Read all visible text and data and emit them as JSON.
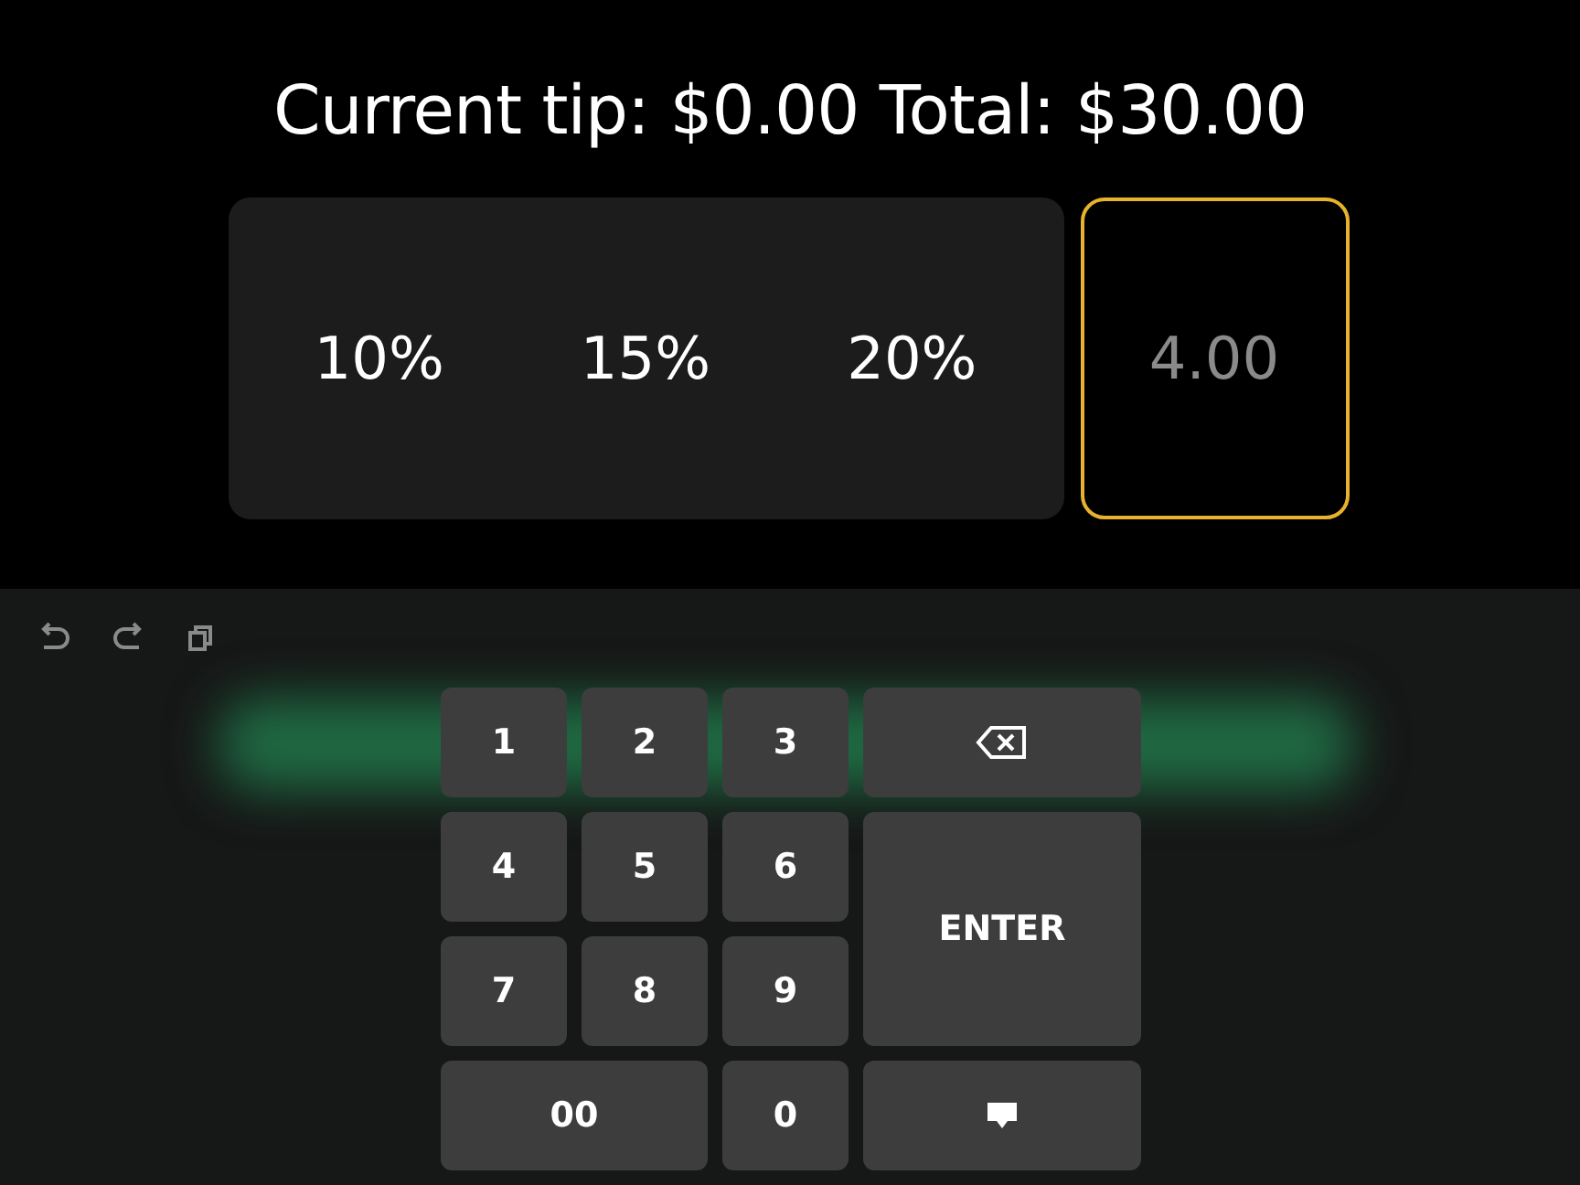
{
  "heading": "Current tip: $0.00 Total: $30.00",
  "tip_options": [
    {
      "label": "10%"
    },
    {
      "label": "15%"
    },
    {
      "label": "20%"
    }
  ],
  "custom_tip": {
    "value": "4.00",
    "focused": true
  },
  "keypad": [
    {
      "kind": "digit",
      "label": "1"
    },
    {
      "kind": "digit",
      "label": "2"
    },
    {
      "kind": "digit",
      "label": "3"
    },
    {
      "kind": "backspace"
    },
    {
      "kind": "digit",
      "label": "4"
    },
    {
      "kind": "digit",
      "label": "5"
    },
    {
      "kind": "digit",
      "label": "6"
    },
    {
      "kind": "enter",
      "label": "ENTER"
    },
    {
      "kind": "digit",
      "label": "7"
    },
    {
      "kind": "digit",
      "label": "8"
    },
    {
      "kind": "digit",
      "label": "9"
    },
    {
      "kind": "double",
      "label": "00"
    },
    {
      "kind": "digit",
      "label": "0"
    },
    {
      "kind": "hide"
    }
  ]
}
